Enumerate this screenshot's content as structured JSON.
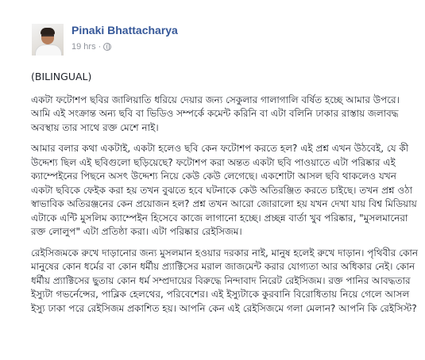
{
  "post": {
    "author": "Pinaki Bhattacharya",
    "time": "19 hrs",
    "separator": "·",
    "privacy_icon": "globe-icon",
    "paragraphs": [
      "(BILINGUAL)",
      "একটা ফটোশপ ছবির জালিয়াতি ধরিয়ে দেয়ার জন্য সেকুলার গালাগালি বর্ষিত হচ্ছে আমার উপরে। আমি এই সংক্রান্ত অন্য ছবি বা ভিডিও সম্পর্কে কমেন্ট করিনি বা এটা বলিনি ঢাকার রাস্তায় জলাবদ্ধ অবস্থায় তার সাথে রক্ত মেশে নাই।",
      "আমার বলার কথা একটাই, একটা হলেও ছবি কেন ফটোশপ করতে হল? এই প্রশ্ন এখন উঠবেই, যে কী উদ্দেশ্য ছিল এই ছবিগুলো ছড়িয়েছে? ফটোশপ করা অন্তত একটা ছবি পাওয়াতে এটা পরিষ্কার এই ক্যাম্পেইনের পিছনে অসৎ উদ্দেশ্য নিয়ে কেউ কেউ লেগেছে। একশোটা আসল ছবি থাকলেও যখন একটা ছবিকে ফেইক করা হয় তখন বুঝতে হবে ঘটনাকে কেউ অতিরঞ্জিত করতে চাইছে। তখন প্রশ্ন ওঠা স্বাভাবিক অতিরঞ্জনের কেন প্রয়োজন হল? প্রশ্ন তখন আরো জোরালো হয় যখন দেখা যায় বিশ্ব মিডিয়ায় এটাকে এন্টি মুসলিম ক্যাম্পেইন হিসেবে কাজে লাগানো হচ্ছে। প্রচ্ছন্ন বার্তা খুব পরিষ্কার, \"মুসলমানেরা রক্ত লোলুপ\" এটা প্রতিষ্ঠা করা। এটা পরিষ্কার রেইসিজম।",
      "রেইসিজমকে রুখে দাড়ানোর জন্য মুসলমান হওয়ার দরকার নাই, মানুষ হলেই রুখে দাড়ান। পৃথিবীর কোন মানুষের কোন ধর্মের বা কোন ধর্মীয় প্র্যাক্টিসের মরাল জাজমেন্ট করার যোগ্যতা আর অধিকার নেই। কোন ধর্মীয় প্র্যাক্টিসের ছুতায় কোন ধর্ম সম্প্রদায়ের বিরুদ্ধে নিন্দাবাদ নিরেট রেইসিজম। রক্ত পানির আবদ্ধতার ইস্যুটা গভর্নেন্সের, পাব্লিক হেলথের, পরিবেশের। এই ইস্যুটাকে কুরবানি বিরোধিতায় নিয়ে গেলে আসল ইস্যু ঢাকা পরে রেইসিজম প্রকাশিত হয়। আপনি কেন এই রেইসিজমে গলা মেলান? আপনি কি রেইসিস্ট?"
    ]
  }
}
